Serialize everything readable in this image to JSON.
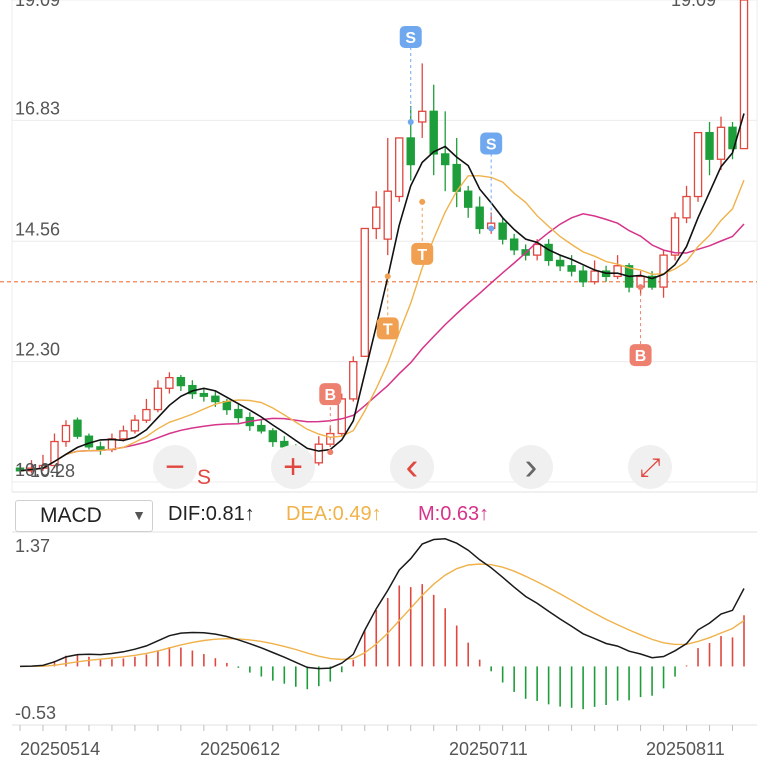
{
  "chart_data": {
    "type": "candlestick",
    "price_axis": {
      "ticks": [
        "19.09",
        "16.83",
        "14.56",
        "12.30",
        "10.04"
      ],
      "ylim": [
        10.04,
        19.09
      ]
    },
    "reference_line": 13.8,
    "markers": [
      {
        "label": "S",
        "day": 34,
        "price": 16.8
      },
      {
        "label": "S",
        "day": 41,
        "price": 14.8
      },
      {
        "label": "T",
        "day": 35,
        "price": 15.3
      },
      {
        "label": "T",
        "day": 32,
        "price": 13.9
      },
      {
        "label": "B",
        "day": 27,
        "price": 10.6
      },
      {
        "label": "B",
        "day": 54,
        "price": 13.7
      }
    ],
    "value_labels": {
      "top_right": "19.09",
      "bottom_left": "10.28"
    },
    "candles": [
      [
        10.3,
        10.25,
        10.4,
        10.2
      ],
      [
        10.25,
        10.3,
        10.45,
        10.2
      ],
      [
        10.3,
        10.35,
        10.55,
        10.25
      ],
      [
        10.35,
        10.8,
        10.95,
        10.3
      ],
      [
        10.8,
        11.1,
        11.2,
        10.7
      ],
      [
        11.2,
        10.9,
        11.25,
        10.85
      ],
      [
        10.9,
        10.7,
        10.95,
        10.65
      ],
      [
        10.7,
        10.65,
        10.8,
        10.55
      ],
      [
        10.65,
        10.85,
        10.95,
        10.6
      ],
      [
        10.85,
        11.0,
        11.1,
        10.8
      ],
      [
        11.0,
        11.2,
        11.3,
        10.95
      ],
      [
        11.2,
        11.4,
        11.6,
        11.15
      ],
      [
        11.4,
        11.8,
        11.95,
        11.35
      ],
      [
        11.8,
        12.0,
        12.1,
        11.7
      ],
      [
        12.0,
        11.85,
        12.05,
        11.75
      ],
      [
        11.85,
        11.7,
        11.95,
        11.6
      ],
      [
        11.7,
        11.65,
        11.8,
        11.55
      ],
      [
        11.65,
        11.55,
        11.75,
        11.45
      ],
      [
        11.55,
        11.4,
        11.6,
        11.3
      ],
      [
        11.4,
        11.25,
        11.5,
        11.15
      ],
      [
        11.25,
        11.1,
        11.35,
        11.0
      ],
      [
        11.1,
        11.0,
        11.2,
        10.95
      ],
      [
        11.0,
        10.8,
        11.05,
        10.7
      ],
      [
        10.8,
        10.7,
        10.9,
        10.6
      ],
      [
        10.7,
        10.5,
        10.75,
        10.4
      ],
      [
        10.5,
        10.35,
        10.55,
        10.3
      ],
      [
        10.4,
        10.75,
        10.9,
        10.35
      ],
      [
        10.75,
        10.95,
        11.1,
        10.7
      ],
      [
        10.95,
        11.6,
        11.7,
        10.9
      ],
      [
        11.6,
        12.3,
        12.4,
        11.55
      ],
      [
        12.4,
        14.8,
        14.8,
        12.4
      ],
      [
        14.8,
        15.2,
        15.5,
        14.6
      ],
      [
        14.6,
        15.5,
        16.5,
        14.3
      ],
      [
        15.4,
        16.5,
        16.5,
        15.3
      ],
      [
        16.5,
        16.0,
        17.1,
        15.7
      ],
      [
        16.8,
        17.0,
        17.9,
        16.5
      ],
      [
        17.0,
        16.2,
        17.5,
        15.8
      ],
      [
        16.2,
        16.0,
        17.0,
        15.5
      ],
      [
        16.0,
        15.5,
        16.5,
        15.2
      ],
      [
        15.5,
        15.2,
        15.6,
        15.0
      ],
      [
        15.2,
        14.8,
        15.4,
        14.7
      ],
      [
        14.8,
        14.9,
        15.1,
        14.7
      ],
      [
        14.9,
        14.6,
        15.0,
        14.5
      ],
      [
        14.6,
        14.4,
        14.7,
        14.3
      ],
      [
        14.4,
        14.3,
        14.5,
        14.2
      ],
      [
        14.3,
        14.5,
        14.6,
        14.2
      ],
      [
        14.5,
        14.2,
        14.6,
        14.1
      ],
      [
        14.2,
        14.1,
        14.3,
        14.0
      ],
      [
        14.1,
        14.0,
        14.3,
        13.9
      ],
      [
        14.0,
        13.8,
        14.1,
        13.7
      ],
      [
        13.8,
        14.0,
        14.2,
        13.75
      ],
      [
        14.0,
        13.9,
        14.1,
        13.8
      ],
      [
        13.9,
        14.1,
        14.3,
        13.85
      ],
      [
        14.1,
        13.7,
        14.15,
        13.6
      ],
      [
        13.7,
        13.9,
        14.0,
        13.55
      ],
      [
        13.9,
        13.7,
        14.0,
        13.65
      ],
      [
        13.7,
        14.3,
        14.4,
        13.5
      ],
      [
        14.3,
        15.0,
        15.1,
        14.2
      ],
      [
        15.0,
        15.4,
        15.6,
        14.9
      ],
      [
        15.4,
        16.6,
        16.6,
        15.3
      ],
      [
        16.6,
        16.1,
        16.8,
        15.8
      ],
      [
        16.1,
        16.7,
        16.9,
        15.9
      ],
      [
        16.7,
        16.3,
        16.8,
        16.1
      ],
      [
        16.3,
        19.09,
        19.3,
        16.3
      ]
    ],
    "dates": [
      "20250514",
      "20250612",
      "20250711",
      "20250811"
    ],
    "macd_axis": {
      "ticks": [
        "1.37",
        "-0.53"
      ],
      "ylim": [
        -0.53,
        1.37
      ]
    },
    "indicator": {
      "name": "MACD",
      "dif": "DIF:0.81↑",
      "dea": "DEA:0.49↑",
      "m": "M:0.63↑"
    },
    "colors": {
      "up": "#e0473f",
      "down": "#1e9e3a",
      "dif": "#1a1a1a",
      "dea": "#f0b24a",
      "ma_long": "#d6338a",
      "marker_s": "#6fa8ee",
      "marker_t": "#f0a050",
      "marker_b": "#ee8070",
      "ref": "#f08050"
    }
  },
  "controls": {
    "minus": "−",
    "plus": "+",
    "left": "‹",
    "right": "›",
    "expand": "⤢",
    "s_label": "S"
  }
}
